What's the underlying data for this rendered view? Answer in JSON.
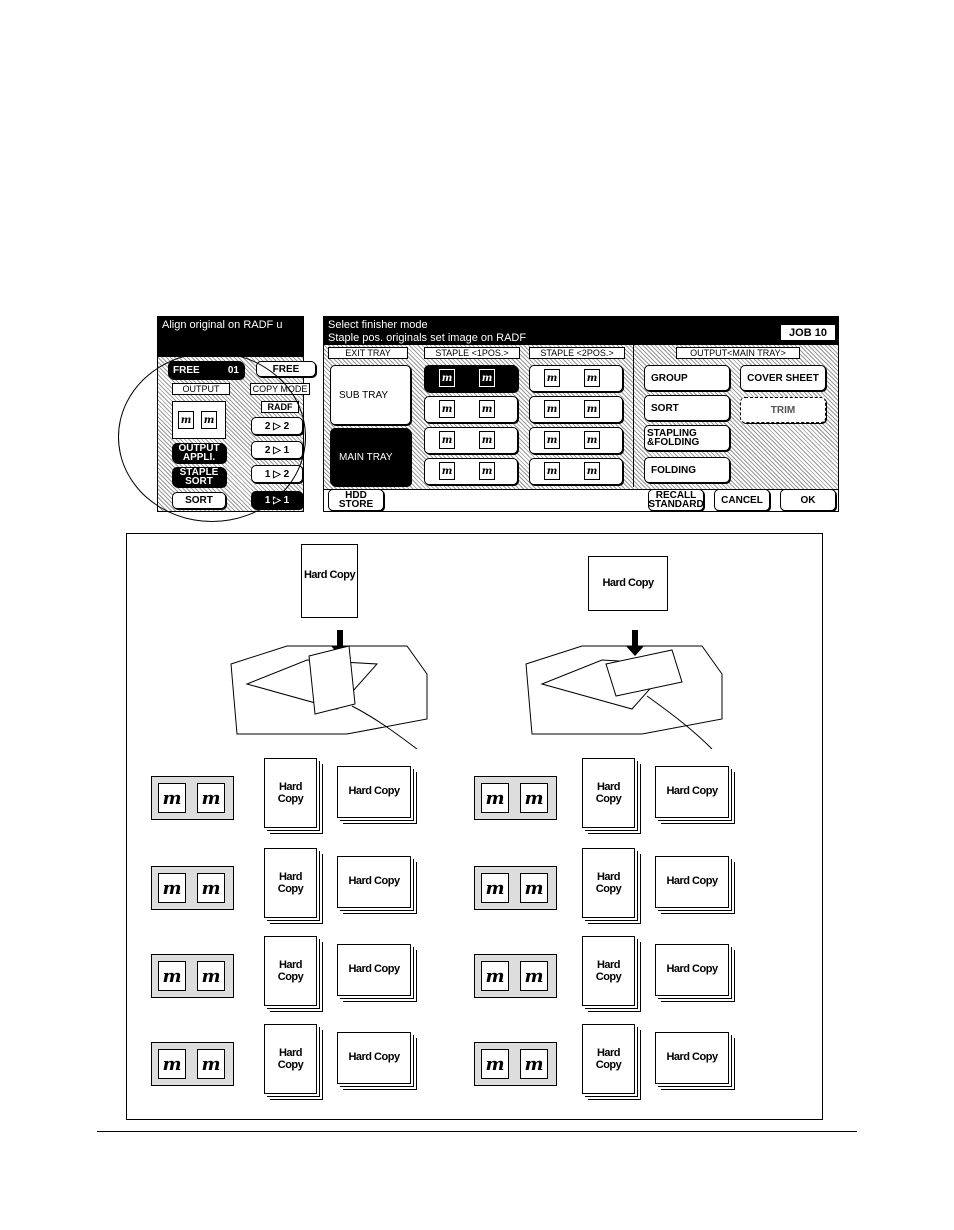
{
  "left_panel": {
    "message": "Align original on RADF u",
    "tab1": "FREE",
    "tab1_num": "01",
    "tab2": "FREE",
    "output_label": "OUTPUT",
    "copy_mode_label": "COPY MODE",
    "radf_label": "RADF",
    "output_appli": "OUTPUT APPLI.",
    "staple_sort": "STAPLE SORT",
    "sort": "SORT",
    "modes": [
      "2 ▷ 2",
      "2 ▷ 1",
      "1 ▷ 2",
      "1 ▷ 1"
    ]
  },
  "right_panel": {
    "line1": "Select finisher mode",
    "line2": "Staple pos. originals set image on RADF",
    "job": "JOB 10",
    "headers": [
      "EXIT TRAY",
      "STAPLE <1POS.>",
      "STAPLE <2POS.>",
      "OUTPUT<MAIN TRAY>"
    ],
    "sub_tray": "SUB TRAY",
    "main_tray": "MAIN TRAY",
    "group": "GROUP",
    "sort": "SORT",
    "stapling_folding": "STAPLING &FOLDING",
    "folding": "FOLDING",
    "cover_sheet": "COVER SHEET",
    "trim": "TRIM",
    "hdd_store": "HDD STORE",
    "recall_standard": "RECALL STANDARD",
    "cancel": "CANCEL",
    "ok": "OK",
    "doc_glyph": "m"
  },
  "illustration": {
    "paper_label": "Hard Copy"
  }
}
